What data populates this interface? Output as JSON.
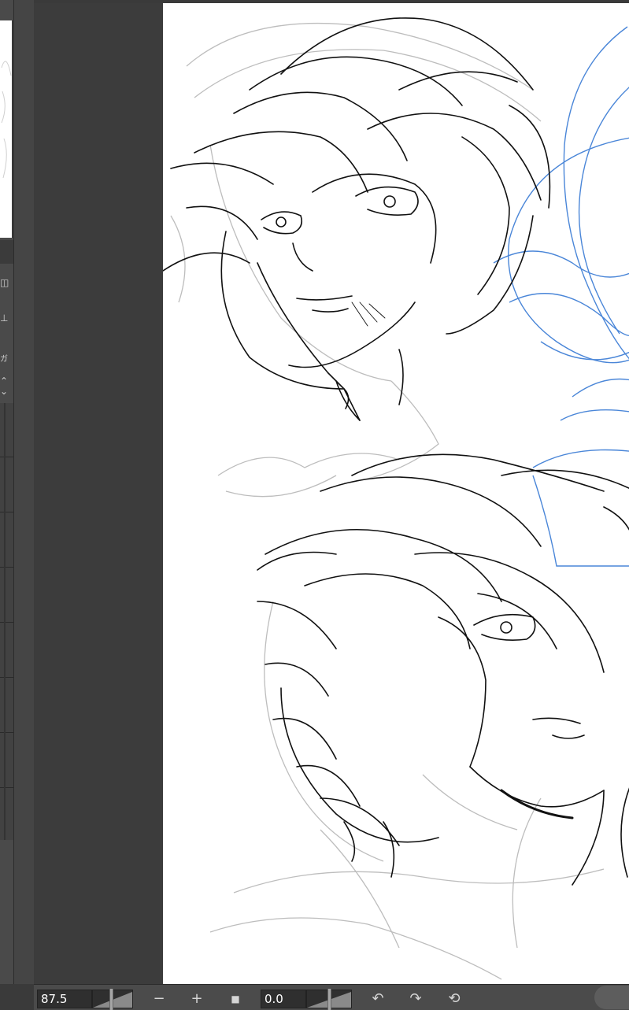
{
  "status_bar": {
    "zoom_value": "87.5",
    "zoom_slider_level": 0.45,
    "zoom_out_label": "−",
    "zoom_in_label": "+",
    "fit_label": "■",
    "rotation_value": "0.0",
    "rotation_slider_level": 0.5,
    "rotate_left_label": "↶",
    "rotate_right_label": "↷",
    "reset_rotation_label": "⟲"
  },
  "left_panel": {
    "icon_glyph_1": "◫",
    "icon_glyph_2": "⊥",
    "icon_glyph_3": "ガ",
    "icon_glyph_4": "⌃",
    "icon_glyph_5": "⌄"
  },
  "canvas": {
    "background_color": "#ffffff",
    "ink_color": "#111111",
    "sketch_color": "#b5b5b5",
    "blue_sketch_color": "#4a86d8"
  },
  "icons": {
    "zoom_out": "minus-icon",
    "zoom_in": "plus-icon",
    "fit": "square-icon",
    "rotate_left": "rotate-left-icon",
    "rotate_right": "rotate-right-icon",
    "reset_rotation": "reset-rotation-icon"
  }
}
